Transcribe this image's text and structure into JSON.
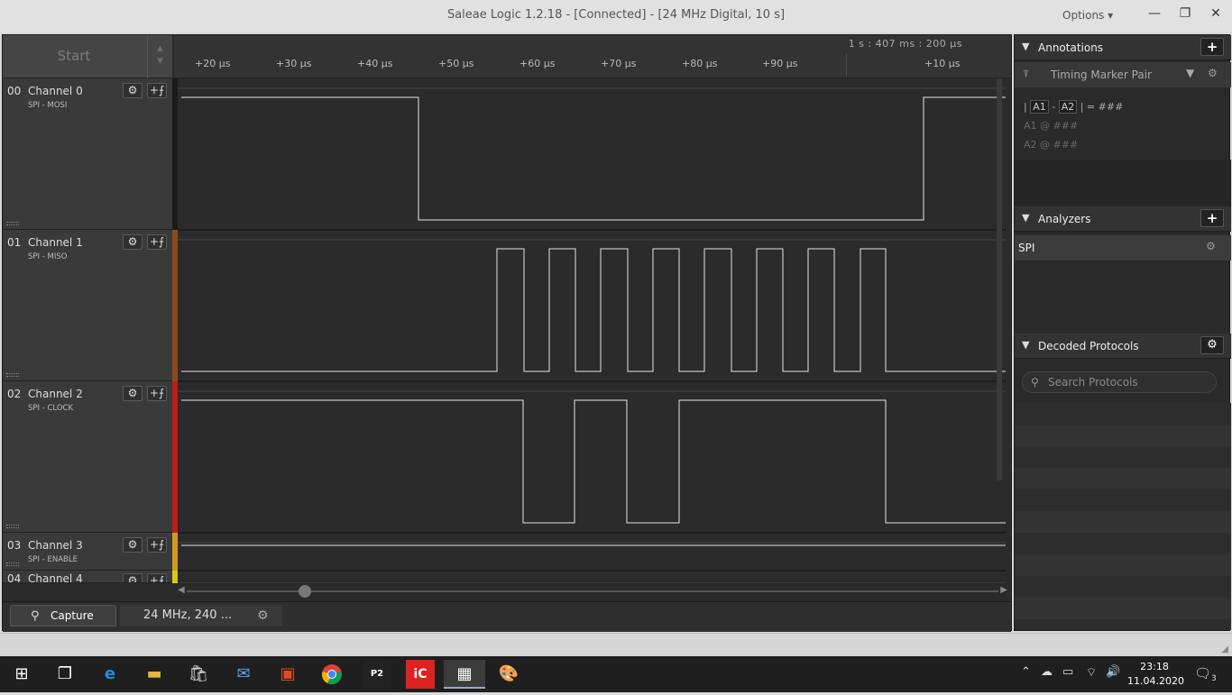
{
  "window": {
    "title": "Saleae Logic 1.2.18 - [Connected] - [24 MHz Digital, 10 s]",
    "options_label": "Options ▾",
    "minimize": "—",
    "restore": "❐",
    "close": "✕"
  },
  "timeline": {
    "start_label": "Start",
    "absolute_time": "1 s : 407 ms : 200 μs",
    "ticks": [
      "+20 μs",
      "+30 μs",
      "+40 μs",
      "+50 μs",
      "+60 μs",
      "+70 μs",
      "+80 μs",
      "+90 μs",
      "+10 μs"
    ]
  },
  "channels": [
    {
      "num": "00",
      "name": "Channel 0",
      "sub": "SPI - MOSI",
      "color": "#1b1b1b"
    },
    {
      "num": "01",
      "name": "Channel 1",
      "sub": "SPI - MISO",
      "color": "#8b4a1c"
    },
    {
      "num": "02",
      "name": "Channel 2",
      "sub": "SPI - CLOCK",
      "color": "#c01a1a"
    },
    {
      "num": "03",
      "name": "Channel 3",
      "sub": "SPI - ENABLE",
      "color": "#d39a1a"
    },
    {
      "num": "04",
      "name": "Channel 4",
      "sub": "",
      "color": "#d8c81c"
    }
  ],
  "bottom": {
    "capture_label": "Capture",
    "rate_label": "24 MHz, 240 ..."
  },
  "annotations": {
    "header": "Annotations",
    "marker_pair": "Timing Marker Pair",
    "line1_a1": "A1",
    "line1_a2": "A2",
    "line1_suffix": "| = ###",
    "line2": "A1  @  ###",
    "line3": "A2  @  ###"
  },
  "analyzers": {
    "header": "Analyzers",
    "item": "SPI"
  },
  "decoded": {
    "header": "Decoded Protocols",
    "search_placeholder": "Search Protocols"
  },
  "taskbar": {
    "time": "23:18",
    "date": "11.04.2020",
    "notif_count": "3"
  }
}
